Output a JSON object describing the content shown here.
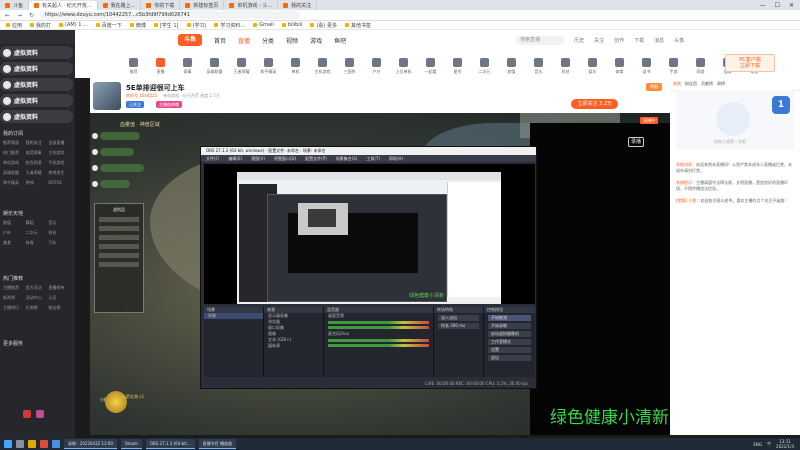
{
  "browser": {
    "tabs": [
      {
        "label": "斗鱼"
      },
      {
        "label": "我在路上..."
      },
      {
        "label": "你的下载"
      },
      {
        "label": "新建标签页"
      },
      {
        "label": "单机游戏 - 斗..."
      },
      {
        "label": "我的关注"
      }
    ],
    "active_tab": {
      "label": "有关超人 · 纪元开荒..."
    },
    "url": "https://www.douyu.com/10442257...c5b3fd9f799d026741",
    "bookmarks": [
      "应用",
      "我的打",
      "(AM) 1 ...",
      "百度一下",
      "微博",
      "[学生 1]",
      "(学习)",
      "学习资料...",
      "Gmail",
      "bilibili",
      "(看) 更多",
      "其他书签"
    ],
    "win_controls": [
      "—",
      "☐",
      "✕"
    ]
  },
  "site": {
    "logo": "斗鱼",
    "nav": [
      "首页",
      "直播",
      "分类",
      "视频",
      "游戏",
      "鱼吧"
    ],
    "active_nav": "直播",
    "search_placeholder": "搜索直播",
    "header_icons": [
      "历史",
      "关注",
      "创作",
      "下载",
      "消息",
      "头像"
    ]
  },
  "categories": [
    "推荐",
    "直播",
    "赛事",
    "英雄联盟",
    "王者荣耀",
    "和平精英",
    "单机",
    "主机游戏",
    "三国杀",
    "户外",
    "上位单机",
    "一起看",
    "星秀",
    "二次元",
    "颜值",
    "音乐",
    "科技",
    "娱乐",
    "体育",
    "读书",
    "手游",
    "网游",
    "战略",
    "萌宠"
  ],
  "promo": {
    "line1": "PC客户端",
    "line2": "立即下载"
  },
  "room": {
    "title": "5E单排迎很可上车",
    "meta_id": "房间号 1044225",
    "meta_user": "单机游戏 · 纪元开荒",
    "meta_viewers": "热度 2.7万",
    "tag1": "已关注",
    "tag2": "主播很帅哦",
    "follow": "立即关注 3.2万",
    "report": "举报"
  },
  "sidebar": {
    "filedrops": [
      "虚拟资料",
      "虚拟资料",
      "虚拟资料",
      "虚拟资料",
      "虚拟资料"
    ],
    "sec1": "我的订阅",
    "grid1": [
      "推荐频道",
      "我的关注",
      "全部直播",
      "热门推荐",
      "电竞赛事",
      "主机游戏",
      "单机游戏",
      "综合网游",
      "手机游戏",
      "英雄联盟",
      "王者荣耀",
      "绝地求生",
      "和平精英",
      "原神",
      "DOTA2"
    ],
    "sec2": "娱乐天地",
    "grid2": [
      "颜值",
      "舞蹈",
      "音乐",
      "户外",
      "二次元",
      "科技",
      "美食",
      "体育",
      "汽车"
    ],
    "sec3": "热门推荐",
    "grid3": [
      "主播推荐",
      "官方活动",
      "直播榜单",
      "新秀榜",
      "活动中心",
      "认证",
      "主播排行",
      "礼物榜",
      "粉丝榜"
    ],
    "sec4": "更多服务"
  },
  "video": {
    "badge": "录播",
    "live_badge": "直播中",
    "hud": "血量值 · 神兽区域",
    "boss_label": "小精灵 · 火灵",
    "panel_title": "战利品",
    "gift_label": "火箭礼物 x1"
  },
  "obs": {
    "title": "OBS 27.1.3 (64-bit, windows) - 配置文件: 未命名 - 场景: 未命名",
    "menu": [
      "文件(F)",
      "编辑(E)",
      "视图(V)",
      "停靠窗口(D)",
      "配置文件(P)",
      "场景集合(S)",
      "工具(T)",
      "帮助(H)"
    ],
    "overlay": "绿色健康小清新",
    "docks": {
      "scenes": {
        "title": "场景",
        "items": [
          "场景"
        ]
      },
      "sources": {
        "title": "来源",
        "items": [
          "显示器采集",
          "浏览器",
          "窗口采集",
          "图像",
          "文本 (GDI+)",
          "媒体源"
        ]
      },
      "mixer": {
        "title": "混音器",
        "items": [
          "桌面音频",
          "麦克风/Aux"
        ]
      },
      "transitions": {
        "title": "转场特效",
        "items": [
          "淡入淡出",
          "时长 300 ms"
        ]
      },
      "controls": {
        "title": "控制按钮",
        "items": [
          "开始推流",
          "开始录制",
          "启动虚拟摄像机",
          "工作室模式",
          "设置",
          "退出"
        ]
      }
    },
    "status": "LIVE: 00:00:00   REC: 00:00:00   CPU: 3.2%, 30.00 fps"
  },
  "watermark": "绿色健康小清新",
  "right_panel": {
    "tabs": [
      "贵宾",
      "粉丝团",
      "贡献榜",
      "周榜"
    ],
    "rank_number": "1",
    "mascot_label": "快来占领第一名吧",
    "messages": [
      {
        "name": "系统消息：",
        "text": "欢迎来到本直播间！斗鱼严禁未成年人直播或打赏，未成年请勿打赏。"
      },
      {
        "name": "系统提示：",
        "text": "主播请遵守法律法规，文明直播，营造良好的直播环境，不得传播违法信息。"
      },
      {
        "name": "[房管] 小鱼：",
        "text": "欢迎各位观众老爷，喜欢主播的点个关注不迷路！"
      }
    ]
  },
  "taskbar": {
    "apps": [
      "录制 · 20220432 13:00",
      "Steam",
      "OBS 27.1.3 (64-bit...",
      "直播节目 播放器"
    ],
    "tray": [
      "ENG",
      "中"
    ],
    "time": "13:11",
    "date": "2022/1/4"
  },
  "colors": {
    "accent": "#ff5d23",
    "watermark": "#3cdc50",
    "obs_bg": "#2b2e38"
  }
}
